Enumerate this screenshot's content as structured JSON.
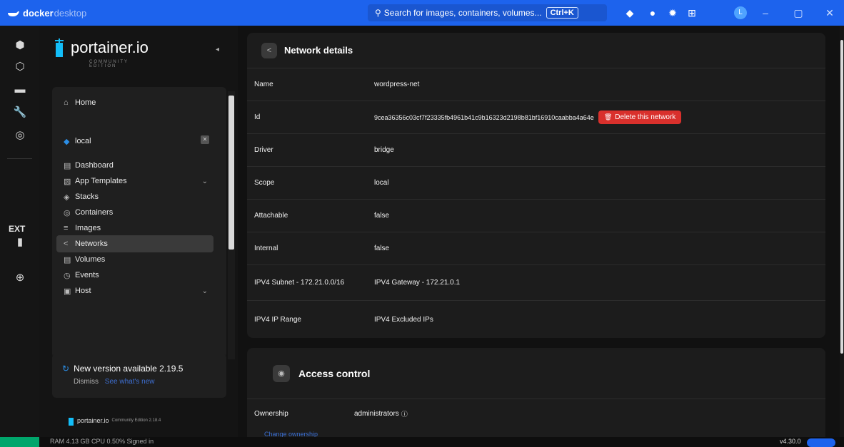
{
  "titlebar": {
    "brand_bold": "docker",
    "brand_light": "desktop",
    "search_placeholder": "Search for images, containers, volumes...",
    "search_shortcut": "Ctrl+K",
    "avatar": "L"
  },
  "rail": {
    "ext_label": "EXT"
  },
  "sidebar": {
    "logo": "portainer.io",
    "logo_sub": "COMMUNITY EDITION",
    "home": "Home",
    "environment": "local",
    "items": [
      {
        "label": "Dashboard"
      },
      {
        "label": "App Templates"
      },
      {
        "label": "Stacks"
      },
      {
        "label": "Containers"
      },
      {
        "label": "Images"
      },
      {
        "label": "Networks"
      },
      {
        "label": "Volumes"
      },
      {
        "label": "Events"
      },
      {
        "label": "Host"
      }
    ],
    "update_title": "New version available 2.19.5",
    "update_dismiss": "Dismiss",
    "update_see_new": "See what's new",
    "footer_brand": "portainer.io",
    "footer_edition": "Community Edition 2.18.4"
  },
  "network_details": {
    "title": "Network details",
    "rows": [
      {
        "key": "Name",
        "value": "wordpress-net"
      },
      {
        "key": "Id",
        "value": "9cea36356c03cf7f23335fb4961b41c9b16323d2198b81bf16910caabba4a64e"
      },
      {
        "key": "Driver",
        "value": "bridge"
      },
      {
        "key": "Scope",
        "value": "local"
      },
      {
        "key": "Attachable",
        "value": "false"
      },
      {
        "key": "Internal",
        "value": "false"
      },
      {
        "key": "IPV4 Subnet - 172.21.0.0/16",
        "value": "IPV4 Gateway - 172.21.0.1"
      },
      {
        "key": "IPV4 IP Range",
        "value": "IPV4 Excluded IPs"
      }
    ],
    "delete_label": "Delete this network"
  },
  "access_control": {
    "title": "Access control",
    "ownership_label": "Ownership",
    "ownership_value": "administrators",
    "change_link": "Change ownership"
  },
  "statusbar": {
    "left_text": "RAM 4.13 GB  CPU 0.50%   Signed in",
    "right_text": "v4.30.0"
  }
}
